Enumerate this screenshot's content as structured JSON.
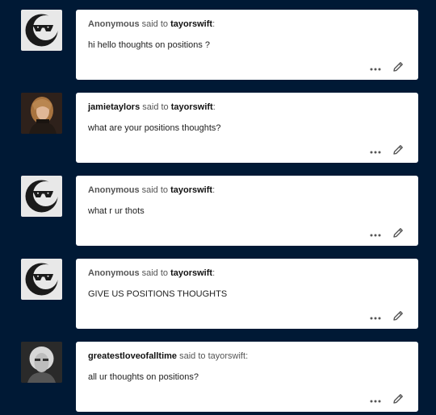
{
  "posts": [
    {
      "asker": "Anonymous",
      "asker_type": "anonymous",
      "said_to": "said to",
      "target": "tayorswift",
      "colon": ":",
      "question": "hi hello thoughts on positions ?"
    },
    {
      "asker": "jamietaylors",
      "asker_type": "user",
      "said_to": "said to",
      "target": "tayorswift",
      "colon": ":",
      "question": "what are your positions thoughts?"
    },
    {
      "asker": "Anonymous",
      "asker_type": "anonymous",
      "said_to": "said to",
      "target": "tayorswift",
      "colon": ":",
      "question": "what r ur thots"
    },
    {
      "asker": "Anonymous",
      "asker_type": "anonymous",
      "said_to": "said to",
      "target": "tayorswift",
      "colon": ":",
      "question": "GIVE US POSITIONS THOUGHTS"
    },
    {
      "asker": "greatestloveofalltime",
      "asker_type": "user",
      "said_to": "said to",
      "target": "tayorswift",
      "colon": ":",
      "question": "all ur thoughts on positions?"
    }
  ],
  "icons": {
    "anon_avatar": "anonymous-sunglasses-avatar-icon",
    "more": "more-options-icon",
    "edit": "edit-pencil-icon"
  },
  "colors": {
    "background": "#001935",
    "card": "#ffffff",
    "icon": "#555555"
  }
}
